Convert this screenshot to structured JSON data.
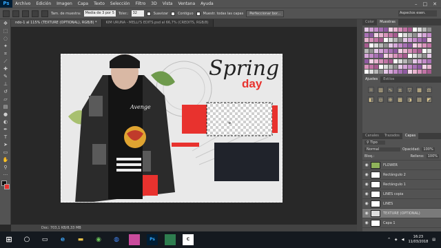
{
  "app": {
    "logo": "Ps"
  },
  "menu": [
    "Archivo",
    "Edición",
    "Imagen",
    "Capa",
    "Texto",
    "Selección",
    "Filtro",
    "3D",
    "Vista",
    "Ventana",
    "Ayuda"
  ],
  "options": {
    "size_label": "Tam. de muestra:",
    "size_value": "Media de 3 por 5",
    "tolerance_label": "Toler.:",
    "tolerance_value": "32",
    "antialias": "Suavizar",
    "contiguous": "Contiguo",
    "sample_all": "Muestr. todas las capas",
    "refine_button": "Perfeccionar bor..."
  },
  "workspace_select": "Aspectos esen.",
  "tabs": [
    {
      "label": "ndo-1 al 115% (TEXTURE (OPTIONAL), RGB/8) *",
      "active": true
    },
    {
      "label": "KIM URUNA - MELLI'S EDITS.psd al 66,7% (CREDITS, RGB/8)",
      "active": false
    }
  ],
  "artwork": {
    "title_script": "Spring",
    "title_sub": "day",
    "shirt_text": "Avenge"
  },
  "status": {
    "doc": "Doc: 703,1 KB/8,33 MB"
  },
  "panels": {
    "swatch_tabs": [
      "Color",
      "Muestras"
    ],
    "adjust_tabs": [
      "Ajustes",
      "Estilos"
    ],
    "layer_tabs": [
      "Canales",
      "Trazados",
      "Capas"
    ],
    "filter_label": "Tipo",
    "blend_mode": "Normal",
    "opacity_label": "Opacidad:",
    "opacity_value": "100%",
    "lock_label": "Bloq.:",
    "fill_label": "Relleno:",
    "fill_value": "100%"
  },
  "layers": [
    "FLOWER",
    "Rectángulo 2",
    "Rectángulo 1",
    "LINES copia",
    "LINES",
    "TEXTURE (OPTIONAL)",
    "Capa 1"
  ],
  "selected_layer": "TEXTURE (OPTIONAL)",
  "taskbar": {
    "time": "16:23",
    "date": "11/03/2018"
  },
  "colors": {
    "accent_red": "#e8322e",
    "dark_rect": "#20232b",
    "ps_blue": "#31a8ff"
  }
}
